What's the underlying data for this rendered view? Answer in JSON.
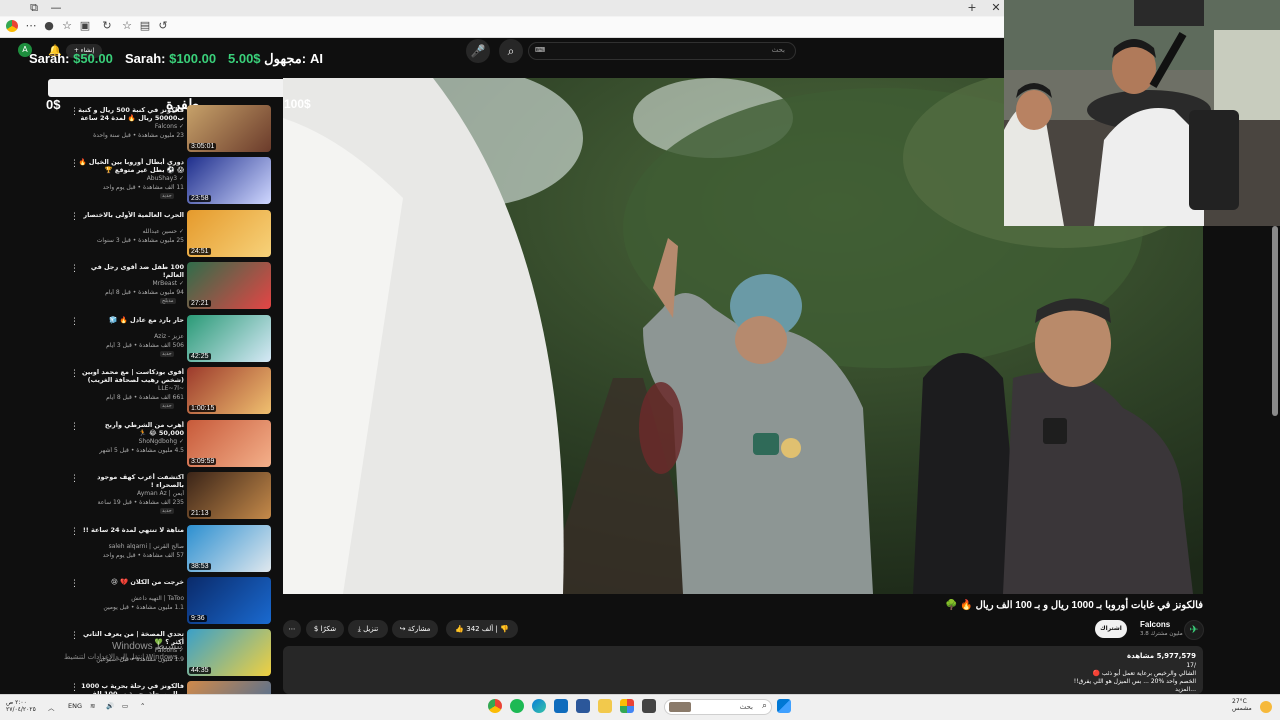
{
  "browser": {
    "toolbar_icons": [
      "back-icon",
      "reload-icon",
      "star-icon",
      "collections-icon",
      "profile-icon"
    ],
    "window_controls": [
      "×",
      "□",
      "—",
      "+"
    ]
  },
  "header": {
    "search_placeholder": "بحث",
    "search_flag": "ℹ︎",
    "create_label": "إنشاء",
    "avatar_letter": "A"
  },
  "donations": [
    {
      "name": "Sarah:",
      "amount": "$50.00"
    },
    {
      "name": "Sarah:",
      "amount": "$100.00"
    },
    {
      "name": "مجهول:",
      "amount": "5.00$"
    },
    {
      "name": "AI",
      "amount": ""
    }
  ],
  "overlay": {
    "left_amount": "0$",
    "middle_label": "طفرة",
    "right_amount": "100$"
  },
  "recommendations": [
    {
      "title": "فالكونز في كنبة 500 ريال و كنبة ب50000 ريال 🔥 لمدة 24 ساعة",
      "channel": "Falcons ✓",
      "meta": "23 مليون مشاهدة • قبل سنة واحدة",
      "duration": "3:05:01",
      "badge": "",
      "colors": [
        "#c7a26a",
        "#6b3b2b"
      ]
    },
    {
      "title": "دوري أبطال أوروبا بين الخيال 🔥 😱 ⚽ بطل غير متوقع 🏆",
      "channel": "AbuShay3 ✓",
      "meta": "11 ألف مشاهدة • قبل يوم واحد",
      "duration": "23:58",
      "badge": "جديد",
      "colors": [
        "#1f2f8c",
        "#cfd7ff"
      ]
    },
    {
      "title": "الحرب العالمية الأولى بالاختصار",
      "channel": "حسين عبدالله ✓",
      "meta": "25 مليون مشاهدة • قبل 3 سنوات",
      "duration": "24:51",
      "badge": "",
      "colors": [
        "#e59a2c",
        "#f7d27a"
      ]
    },
    {
      "title": "100 طفل ضد أقوى رجل في العالم!",
      "channel": "MrBeast ✓",
      "meta": "94 مليون مشاهدة • قبل 8 أيام",
      "duration": "27:21",
      "badge": "مدبلج",
      "colors": [
        "#2f6d4a",
        "#e54545"
      ]
    },
    {
      "title": "حار بارد مع عادل 🔥 🧊",
      "channel": "Aziz - عزيز",
      "meta": "506 ألف مشاهدة • قبل 3 أيام",
      "duration": "42:25",
      "badge": "جديد",
      "colors": [
        "#2a9a76",
        "#d7e9f7"
      ]
    },
    {
      "title": "أقوى بودكاست | مع محمد اوبين (شخص رهيب لصحافة الغريب) 🎙️ 🔴",
      "channel": "LLE~7l~",
      "meta": "661 ألف مشاهدة • قبل 8 أيام",
      "duration": "1:00:15",
      "badge": "جديد",
      "colors": [
        "#9c3a2c",
        "#f0c070"
      ]
    },
    {
      "title": "أهرب من الشرطي وأربح 50,000 😂 🏃",
      "channel": "ShoNgdbohg ✓",
      "meta": "4.5 مليون مشاهدة • قبل 5 أشهر",
      "duration": "3:09:59",
      "badge": "",
      "colors": [
        "#c75a3a",
        "#f4b08a"
      ]
    },
    {
      "title": "اكتشفت أعرب كهف موجود بالصحراء !",
      "channel": "Ayman Az | أيمن",
      "meta": "235 ألف مشاهدة • قبل 19 ساعة",
      "duration": "21:13",
      "badge": "جديد",
      "colors": [
        "#3a2418",
        "#c58a4a"
      ]
    },
    {
      "title": "متاهة لا تنتهي لمدة 24 ساعة !!",
      "channel": "saleh alqarni | صالح القرني",
      "meta": "57 ألف مشاهدة • قبل يوم واحد",
      "duration": "38:53",
      "badge": "",
      "colors": [
        "#2c8fd0",
        "#e0e8ee"
      ]
    },
    {
      "title": "خرجت من الكلان 💔 😢",
      "channel": "التهيه داعش | TaToo",
      "meta": "1.1 مليون مشاهدة • قبل يومين",
      "duration": "9:36",
      "badge": "",
      "colors": [
        "#0a2a6a",
        "#1a6ad0"
      ]
    },
    {
      "title": "تحدي المصخة | من يعرف الثاني أكثر ؟ 💚",
      "channel": "Falcons ✓",
      "meta": "1.9 مليون مشاهدة • قبل أسبوعين",
      "duration": "44:35",
      "badge": "",
      "colors": [
        "#3aa0c8",
        "#f0d040"
      ]
    },
    {
      "title": "فالكونز في رحلة بحرية ب 1000 ريال ورحلة بحرية ب 100 الف ريال 🔥",
      "channel": "Falcons ✓",
      "meta": "",
      "duration": "",
      "badge": "",
      "colors": [
        "#d08a4a",
        "#3a6aa0"
      ]
    }
  ],
  "video": {
    "title": "فالكونز في غابات أوروبا بـ 1000 ريال و بـ 100 الف ريال 🔥 🌳",
    "channel": "Falcons",
    "subscribers": "3.8 مليون مشترك",
    "subscribe_label": "اشتراك",
    "likes": "342 ألف",
    "share_label": "مشاركة",
    "download_label": "تنزيل",
    "thanks_label": "شكرًا",
    "more_label": "⋯",
    "views": "5,977,579 مشاهدة",
    "date": "17/",
    "desc_line1": "الشالي والرخيص برعاية تعمل أبو ذئب 🔴",
    "desc_line2": "الخصم واحد %20 ... بس الميزل هو اللي يفرق!!",
    "desc_line3": "...المزيد"
  },
  "watermark": {
    "title": "Windows تنشيط",
    "subtitle": "انتقل إلى الإعدادات لتنشيط Windows."
  },
  "taskbar": {
    "search_placeholder": "بحث",
    "lang": "ENG",
    "time": "٢:٠٠ ص",
    "date": "٢٧/٠٤/٢٠٢٥",
    "weather_temp": "27°C",
    "weather_desc": "مشمس"
  }
}
